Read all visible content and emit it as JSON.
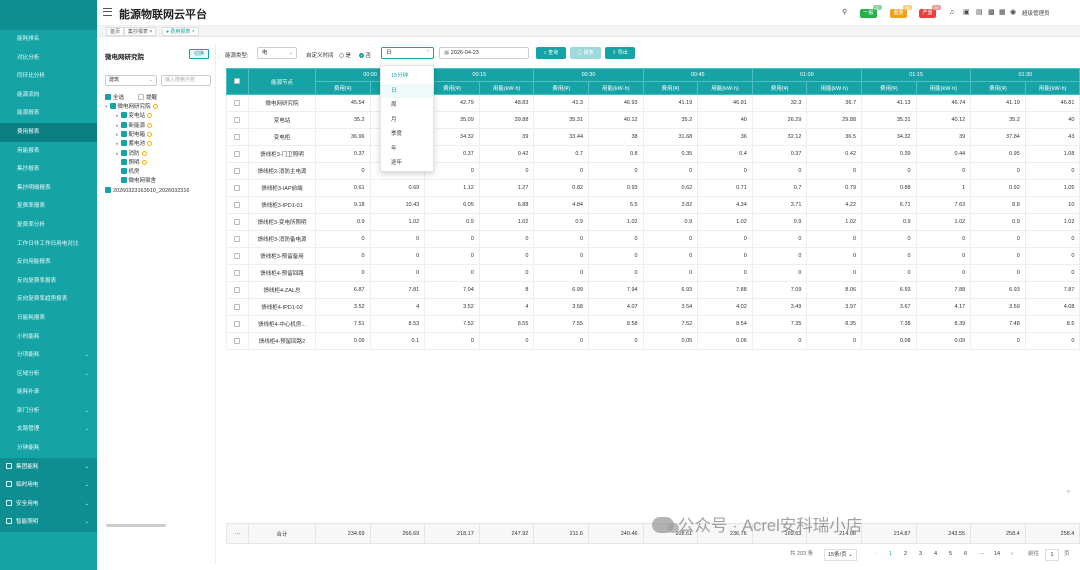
{
  "app": {
    "title": "能源物联网云平台"
  },
  "sidebar": {
    "items": [
      "能耗排名",
      "对比分析",
      "同环比分析",
      "能源流向",
      "能源报表",
      "费用报表",
      "用能报表",
      "集抄报表",
      "集抄明细报表",
      "复费率报表",
      "复费率分析",
      "工作日非工作日用电对比",
      "反向用能报表",
      "反向复费率报表",
      "反向复费率趋势报表",
      "日能耗报表",
      "小时能耗",
      "分项能耗",
      "区域分析",
      "能耗补录",
      "部门分析",
      "支路管理",
      "分钟能耗"
    ],
    "active_index": 5,
    "expandable": [
      17,
      18,
      20,
      21
    ],
    "groups": [
      "集团能耗",
      "临时用电",
      "安全用电",
      "智能照明"
    ]
  },
  "topbar": {
    "icons": [
      "search-icon",
      "mute-icon",
      "screen-icon",
      "image-icon",
      "code-icon",
      "grid-icon",
      "user-icon"
    ],
    "badges": [
      {
        "label": "一般",
        "sup": "1",
        "color": "#26b14b"
      },
      {
        "label": "重要",
        "sup": "30",
        "color": "#f0a11a"
      },
      {
        "label": "严重",
        "sup": "97",
        "color": "#e84040"
      }
    ],
    "user": "超级管理员"
  },
  "tabs": [
    {
      "label": "首页",
      "closable": false,
      "active": false
    },
    {
      "label": "集抄报表",
      "closable": true,
      "active": false
    },
    {
      "label": "费用报表",
      "closable": true,
      "active": true
    }
  ],
  "tree": {
    "title": "微电网研究院",
    "switch": "切换",
    "type_select": "建筑",
    "search_placeholder": "输入搜索内容",
    "select_all": "全选",
    "fold": "提醒",
    "nodes": [
      {
        "label": "微电网研究院",
        "level": 0,
        "expand": "▾",
        "hint": true
      },
      {
        "label": "变电站",
        "level": 1,
        "expand": "▸",
        "hint": true
      },
      {
        "label": "新能源",
        "level": 1,
        "expand": "▸",
        "hint": true
      },
      {
        "label": "配电箱",
        "level": 1,
        "expand": "▸",
        "hint": true
      },
      {
        "label": "蓄电池",
        "level": 1,
        "expand": "▸",
        "hint": true
      },
      {
        "label": "消防",
        "level": 1,
        "expand": "▸",
        "hint": true
      },
      {
        "label": "照明",
        "level": 1,
        "expand": "",
        "hint": true
      },
      {
        "label": "机房",
        "level": 1,
        "expand": "",
        "hint": false
      },
      {
        "label": "微电网宿舍",
        "level": 1,
        "expand": "",
        "hint": false
      },
      {
        "label": "20260323163910_2026032316",
        "level": 0,
        "expand": "",
        "hint": false
      }
    ]
  },
  "filter": {
    "energy_type_label": "能源类型:",
    "energy_type": "电",
    "custom_time_label": "自定义时间",
    "radio_yes": "是",
    "radio_no": "否",
    "granularity": "日",
    "date": "2026-04-23",
    "query": "查询",
    "report": "报表",
    "export": "导出"
  },
  "dropdown": {
    "options": [
      "15分钟",
      "日",
      "周",
      "月",
      "季度",
      "年",
      "逐年"
    ],
    "selected": 1
  },
  "table": {
    "node_header": "能源节点",
    "times": [
      "00:00",
      "00:15",
      "00:30",
      "00:45",
      "01:00",
      "01:15",
      "01:30"
    ],
    "sub_headers": [
      "费用(¥)",
      "用能(kW·h)"
    ],
    "rows": [
      {
        "node": "微电网研究院",
        "v": [
          "45.54",
          "51.98",
          "42.79",
          "48.83",
          "41.3",
          "46.93",
          "41.19",
          "46.81",
          "32.3",
          "36.7",
          "41.13",
          "46.74",
          "41.19",
          "46.81"
        ]
      },
      {
        "node": "变电站",
        "v": [
          "35.2",
          "40",
          "35.09",
          "39.88",
          "35.31",
          "40.12",
          "35.2",
          "40",
          "26.29",
          "29.88",
          "35.31",
          "40.12",
          "35.2",
          "40"
        ]
      },
      {
        "node": "变电柜",
        "v": [
          "36.96",
          "42",
          "34.32",
          "39",
          "33.44",
          "38",
          "31.68",
          "36",
          "32.12",
          "36.5",
          "34.32",
          "39",
          "37.84",
          "43"
        ]
      },
      {
        "node": "馈线柜3-门卫照明",
        "v": [
          "0.37",
          "0.42",
          "0.37",
          "0.42",
          "0.7",
          "0.8",
          "0.35",
          "0.4",
          "0.37",
          "0.42",
          "0.39",
          "0.44",
          "0.95",
          "1.08"
        ]
      },
      {
        "node": "馈线柜2-消防主电源",
        "v": [
          "0",
          "0",
          "0",
          "0",
          "0",
          "0",
          "0",
          "0",
          "0",
          "0",
          "0",
          "0",
          "0",
          "0"
        ]
      },
      {
        "node": "馈线柜3-IAP前端",
        "v": [
          "0.61",
          "0.69",
          "1.12",
          "1.27",
          "0.82",
          "0.93",
          "0.62",
          "0.71",
          "0.7",
          "0.79",
          "0.88",
          "1",
          "0.92",
          "1.05"
        ]
      },
      {
        "node": "馈线柜3-IPD1-01",
        "v": [
          "9.18",
          "10.43",
          "6.05",
          "6.88",
          "4.84",
          "5.5",
          "3.82",
          "4.34",
          "3.71",
          "4.22",
          "6.71",
          "7.63",
          "8.8",
          "10"
        ]
      },
      {
        "node": "馈线柜3-变电所照明",
        "v": [
          "0.9",
          "1.02",
          "0.9",
          "1.02",
          "0.9",
          "1.02",
          "0.9",
          "1.02",
          "0.9",
          "1.02",
          "0.9",
          "1.02",
          "0.9",
          "1.02"
        ]
      },
      {
        "node": "馈线柜3-消防备电源",
        "v": [
          "0",
          "0",
          "0",
          "0",
          "0",
          "0",
          "0",
          "0",
          "0",
          "0",
          "0",
          "0",
          "0",
          "0"
        ]
      },
      {
        "node": "馈线柜3-预留备用",
        "v": [
          "0",
          "0",
          "0",
          "0",
          "0",
          "0",
          "0",
          "0",
          "0",
          "0",
          "0",
          "0",
          "0",
          "0"
        ]
      },
      {
        "node": "馈线柜4-预留回路",
        "v": [
          "0",
          "0",
          "0",
          "0",
          "0",
          "0",
          "0",
          "0",
          "0",
          "0",
          "0",
          "0",
          "0",
          "0"
        ]
      },
      {
        "node": "馈线柜4-ZAL总",
        "v": [
          "6.87",
          "7.81",
          "7.04",
          "8",
          "6.99",
          "7.94",
          "6.93",
          "7.88",
          "7.09",
          "8.06",
          "6.93",
          "7.88",
          "6.93",
          "7.87"
        ]
      },
      {
        "node": "馈线柜4-IPD1-02",
        "v": [
          "3.52",
          "4",
          "3.52",
          "4",
          "3.58",
          "4.07",
          "3.54",
          "4.02",
          "3.49",
          "3.97",
          "3.67",
          "4.17",
          "3.59",
          "4.08"
        ]
      },
      {
        "node": "馈线柜4-中心机房...",
        "v": [
          "7.51",
          "8.53",
          "7.52",
          "8.55",
          "7.55",
          "8.58",
          "7.52",
          "8.54",
          "7.35",
          "8.35",
          "7.38",
          "8.39",
          "7.48",
          "8.5"
        ]
      },
      {
        "node": "馈线柜4-预留回路2",
        "v": [
          "0.09",
          "0.1",
          "0",
          "0",
          "0",
          "0",
          "0.05",
          "0.06",
          "0",
          "0",
          "0.08",
          "0.09",
          "0",
          "0"
        ]
      }
    ],
    "footer": {
      "dots": "···",
      "label": "合计",
      "v": [
        "234.69",
        "266.69",
        "218.17",
        "247.92",
        "211.6",
        "240.46",
        "208.61",
        "236.76",
        "169.63",
        "214.08",
        "214.87",
        "243.55",
        "258.4",
        "258.4"
      ]
    }
  },
  "pagination": {
    "total": "共 203 条",
    "page_size": "15条/页",
    "prev": "‹",
    "pages": [
      "1",
      "2",
      "3",
      "4",
      "5",
      "6",
      "···",
      "14"
    ],
    "next": "›",
    "goto_label": "前往",
    "goto_value": "1",
    "goto_unit": "页"
  },
  "watermark": "公众号 · Acrel安科瑞小店"
}
